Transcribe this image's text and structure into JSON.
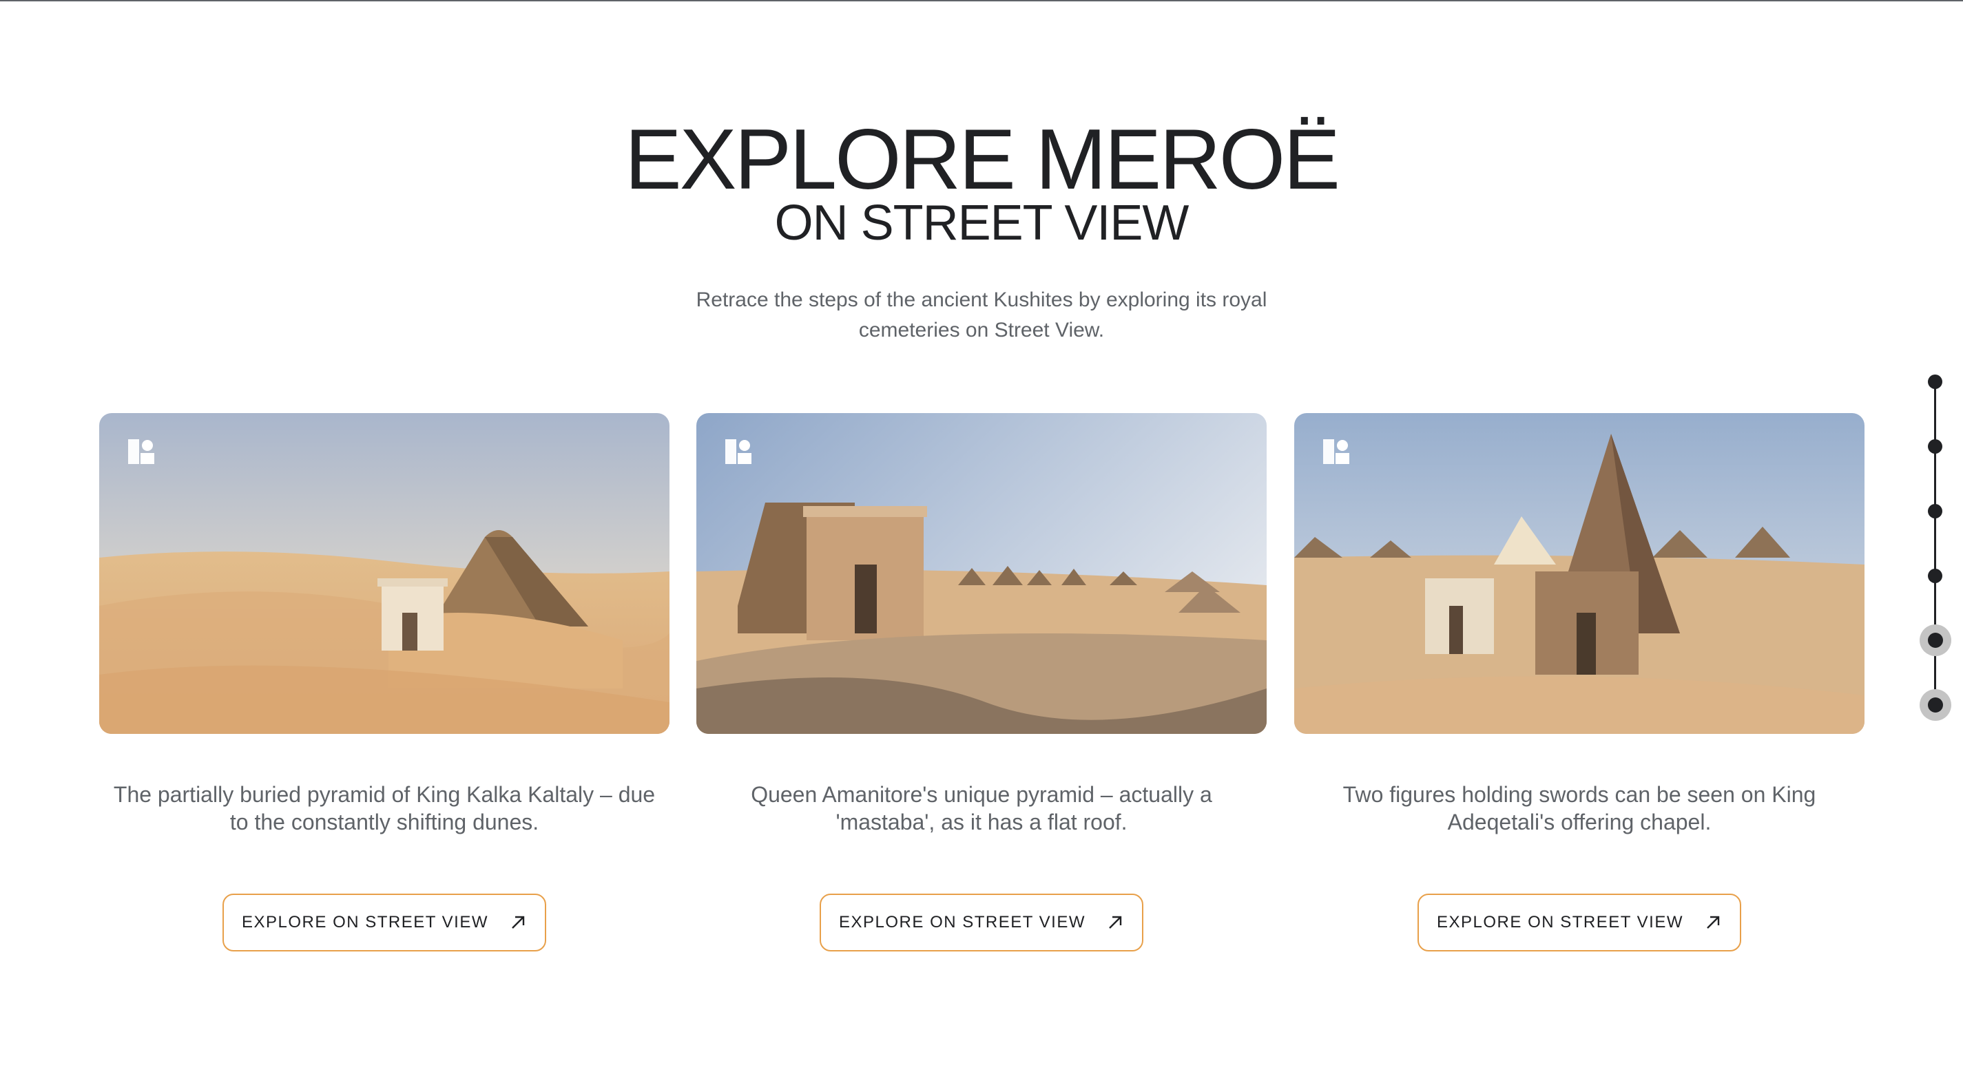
{
  "page": {
    "title_line1": "EXPLORE MEROË",
    "title_line2": "ON STREET VIEW",
    "subtitle": "Retrace the steps of the ancient Kushites by exploring its royal cemeteries on Street View."
  },
  "cards": [
    {
      "caption": "The partially buried pyramid of King Kalka Kaltaly – due to the constantly shifting dunes.",
      "button_label": "EXPLORE ON STREET VIEW",
      "badge_icon": "street-view-icon",
      "button_icon": "arrow-up-right-icon"
    },
    {
      "caption": "Queen Amanitore's unique pyramid – actually a 'mastaba', as it has a flat roof.",
      "button_label": "EXPLORE ON STREET VIEW",
      "badge_icon": "street-view-icon",
      "button_icon": "arrow-up-right-icon"
    },
    {
      "caption": "Two figures holding swords can be seen on King Adeqetali's offering chapel.",
      "button_label": "EXPLORE ON STREET VIEW",
      "badge_icon": "street-view-icon",
      "button_icon": "arrow-up-right-icon"
    }
  ],
  "section_progress": {
    "total_sections": 6,
    "active_sections": [
      5,
      6
    ]
  },
  "colors": {
    "button_border": "#e8a04a",
    "text_primary": "#202124",
    "text_secondary": "#5f6368"
  }
}
